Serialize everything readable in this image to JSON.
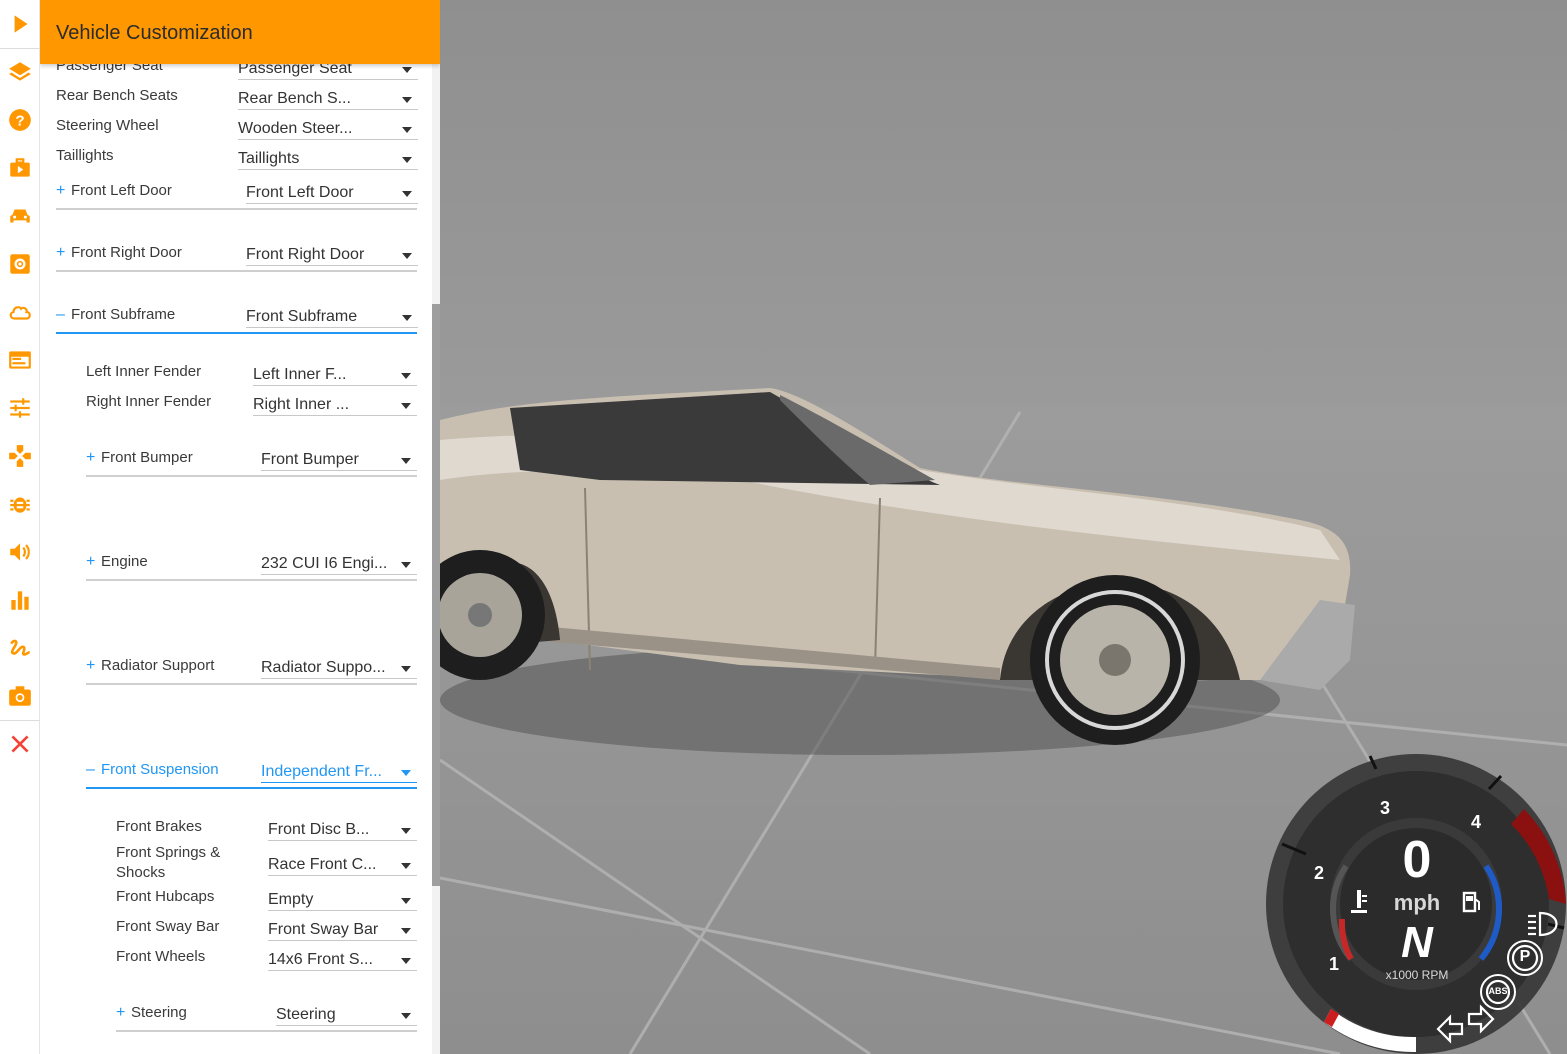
{
  "panel": {
    "title": "Vehicle Customization",
    "expand_symbol": "+",
    "collapse_symbol": "–",
    "rows": [
      {
        "label": "Passenger Seat",
        "value": "Passenger Seat"
      },
      {
        "label": "Rear Bench Seats",
        "value": "Rear Bench S..."
      },
      {
        "label": "Steering Wheel",
        "value": "Wooden Steer..."
      },
      {
        "label": "Taillights",
        "value": "Taillights"
      },
      {
        "label": "Front Left Door",
        "value": "Front Left Door"
      },
      {
        "label": "Front Right Door",
        "value": "Front Right Door"
      },
      {
        "label": "Front Subframe",
        "value": "Front Subframe"
      },
      {
        "label": "Left Inner Fender",
        "value": "Left Inner F..."
      },
      {
        "label": "Right Inner Fender",
        "value": "Right Inner ..."
      },
      {
        "label": "Front Bumper",
        "value": "Front Bumper"
      },
      {
        "label": "Engine",
        "value": "232 CUI I6 Engi..."
      },
      {
        "label": "Radiator Support",
        "value": "Radiator Suppo..."
      },
      {
        "label": "Front Suspension",
        "value": "Independent Fr..."
      },
      {
        "label": "Front Brakes",
        "value": "Front Disc B..."
      },
      {
        "label": "Front Springs & Shocks",
        "value": "Race Front C..."
      },
      {
        "label": "Front Hubcaps",
        "value": "Empty"
      },
      {
        "label": "Front Sway Bar",
        "value": "Front Sway Bar"
      },
      {
        "label": "Front Wheels",
        "value": "14x6 Front S..."
      },
      {
        "label": "Steering",
        "value": "Steering"
      }
    ]
  },
  "iconbar": {
    "icons": [
      "play-icon",
      "layers-icon",
      "help-icon",
      "briefcase-icon",
      "car-icon",
      "settings-icon",
      "cloud-icon",
      "web-asset-icon",
      "tune-icon",
      "gamepad-icon",
      "bug-icon",
      "volume-icon",
      "chart-icon",
      "gesture-icon",
      "camera-icon",
      "close-icon"
    ],
    "accent_color": "#ff9800",
    "close_color": "#f44336"
  },
  "hud": {
    "speed": "0",
    "speed_unit": "mph",
    "gear": "N",
    "rpm_label": "x1000 RPM",
    "ticks": [
      "1",
      "2",
      "3",
      "4"
    ],
    "abs_label": "ABS",
    "parking_label": "P"
  },
  "colors": {
    "header": "#ff9800",
    "accent_blue": "#2196f3",
    "redline": "#8b1111"
  }
}
